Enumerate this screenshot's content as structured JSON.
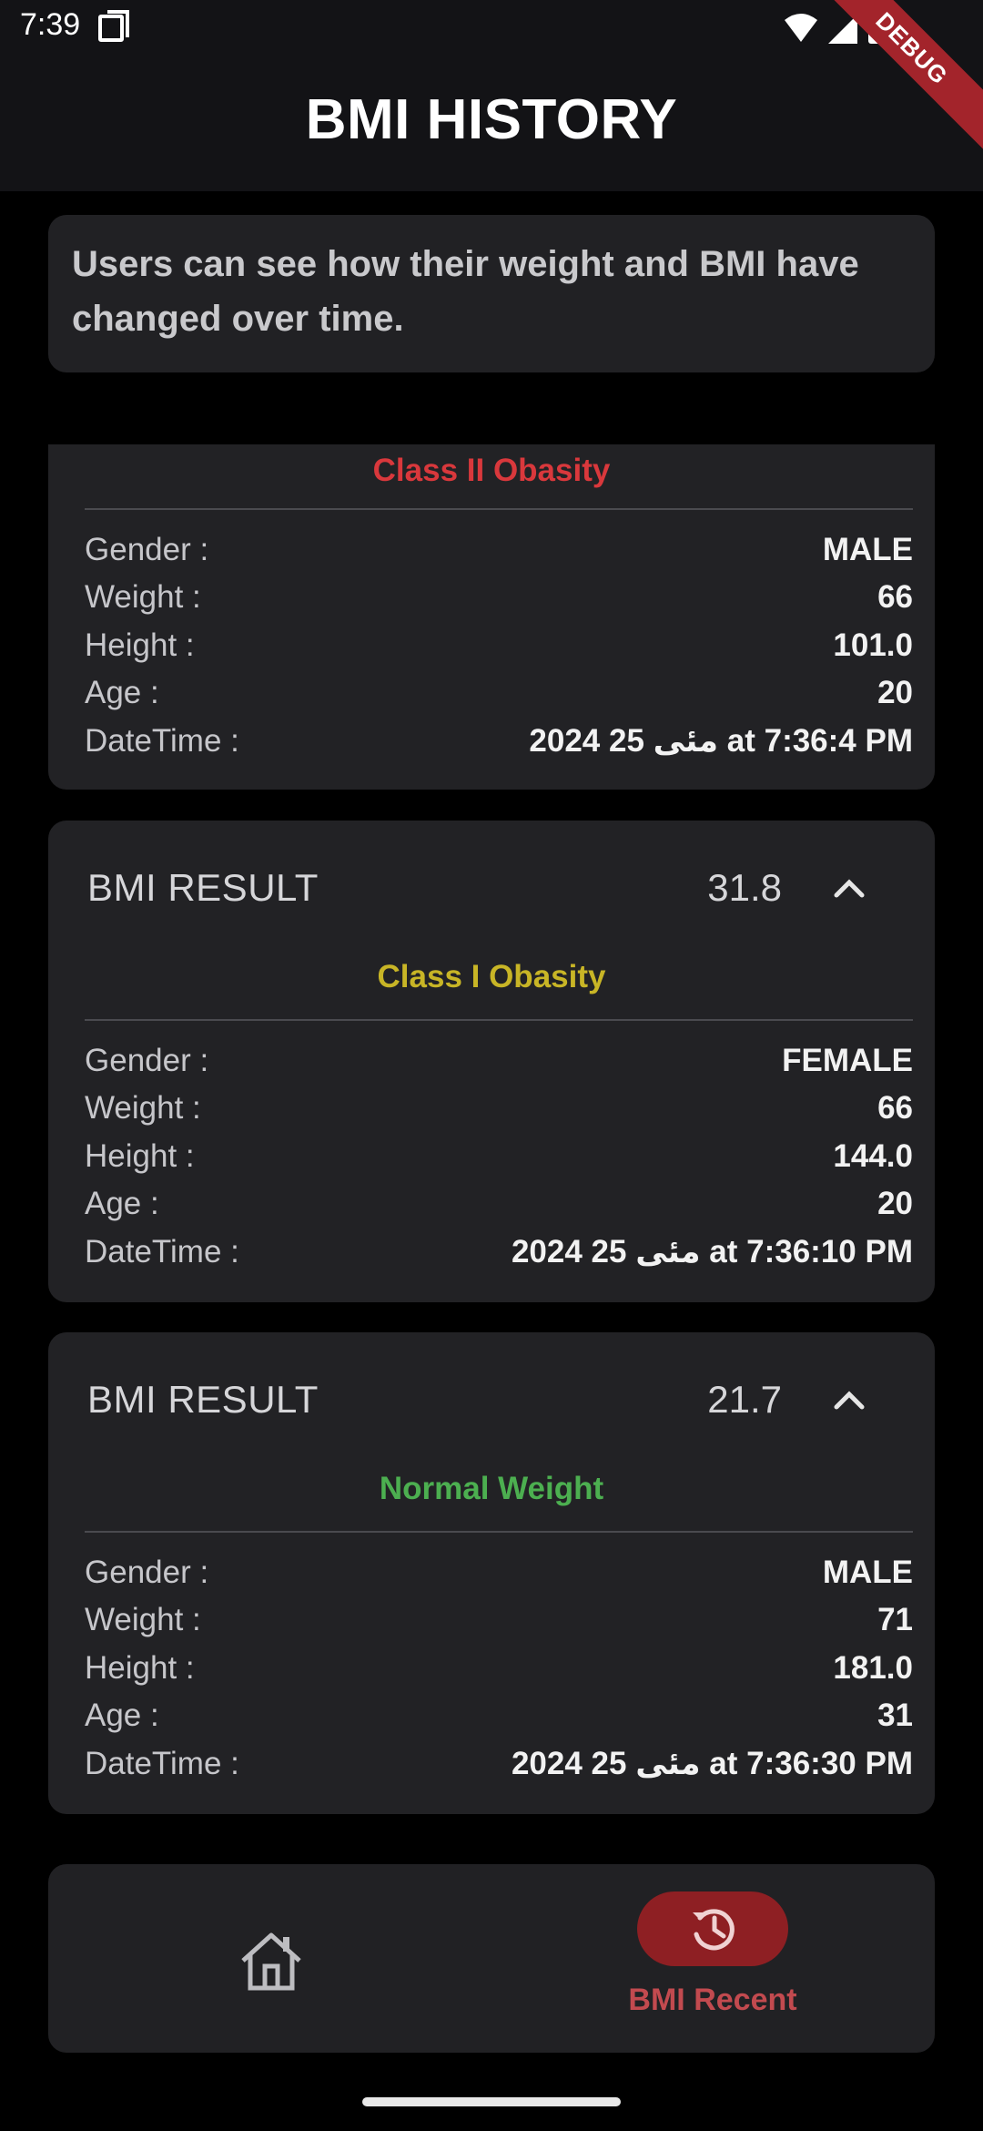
{
  "status_bar": {
    "time": "7:39",
    "debug_banner": "DEBUG"
  },
  "app_bar": {
    "title": "BMI HISTORY"
  },
  "info_card": {
    "text": "Users can see how their weight and BMI have changed over time."
  },
  "field_labels": {
    "gender": "Gender :",
    "weight": "Weight :",
    "height": "Height :",
    "age": "Age :",
    "datetime": "DateTime :"
  },
  "history": [
    {
      "header_label": "",
      "bmi": "",
      "category": "Class II Obasity",
      "category_color": "#d9383c",
      "gender": "MALE",
      "weight": "66",
      "height": "101.0",
      "age": "20",
      "datetime": "2024 25 مئی at 7:36:4 PM"
    },
    {
      "header_label": "BMI RESULT",
      "bmi": "31.8",
      "category": "Class I Obasity",
      "category_color": "#c8b526",
      "gender": "FEMALE",
      "weight": "66",
      "height": "144.0",
      "age": "20",
      "datetime": "2024 25 مئی at 7:36:10 PM"
    },
    {
      "header_label": "BMI RESULT",
      "bmi": "21.7",
      "category": "Normal Weight",
      "category_color": "#4caf50",
      "gender": "MALE",
      "weight": "71",
      "height": "181.0",
      "age": "31",
      "datetime": "2024 25 مئی at 7:36:30 PM"
    }
  ],
  "bottom_nav": {
    "items": [
      {
        "icon": "home-icon",
        "label": ""
      },
      {
        "icon": "history-icon",
        "label": "BMI Recent",
        "active": true
      }
    ],
    "active_color": "#8e1f23"
  }
}
